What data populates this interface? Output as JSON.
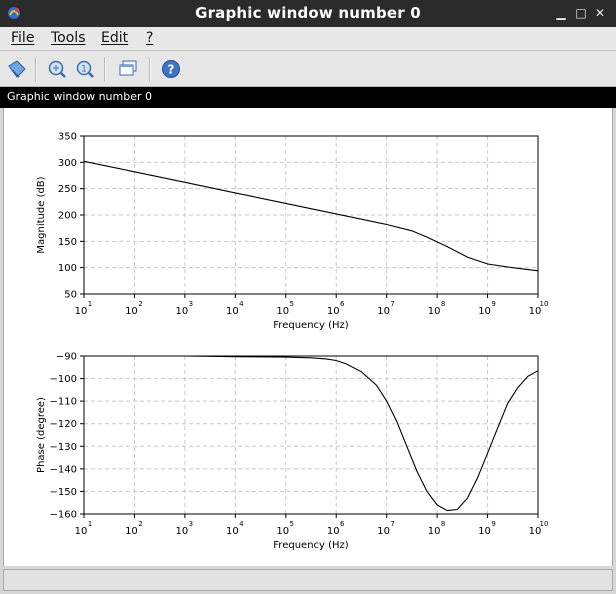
{
  "window": {
    "title": "Graphic window number 0"
  },
  "menu": [
    {
      "label": "File"
    },
    {
      "label": "Tools"
    },
    {
      "label": "Edit"
    },
    {
      "label": "?"
    }
  ],
  "toolbar": {
    "icons": [
      "datatip-icon",
      "zoom-icon",
      "unzoom-icon",
      "window-icon",
      "help-icon"
    ]
  },
  "figure": {
    "label": "Graphic window number 0"
  },
  "chart_data": [
    {
      "type": "line",
      "xscale": "log",
      "xlim": [
        10,
        10000000000
      ],
      "ylim": [
        50,
        350
      ],
      "xlabel": "Frequency (Hz)",
      "ylabel": "Magnitude (dB)",
      "grid": true,
      "xticks": [
        {
          "base": "10",
          "exp": "1"
        },
        {
          "base": "10",
          "exp": "2"
        },
        {
          "base": "10",
          "exp": "3"
        },
        {
          "base": "10",
          "exp": "4"
        },
        {
          "base": "10",
          "exp": "5"
        },
        {
          "base": "10",
          "exp": "6"
        },
        {
          "base": "10",
          "exp": "7"
        },
        {
          "base": "10",
          "exp": "8"
        },
        {
          "base": "10",
          "exp": "9"
        },
        {
          "base": "10",
          "exp": "10"
        }
      ],
      "yticks": [
        "350",
        "300",
        "250",
        "200",
        "150",
        "100",
        "50"
      ],
      "series": [
        {
          "log10_x": [
            1,
            2,
            3,
            4,
            5,
            6,
            6.5,
            7,
            7.5,
            7.8,
            8.2,
            8.6,
            9,
            9.5,
            10
          ],
          "y": [
            302,
            282,
            262,
            242,
            222,
            202,
            192,
            182,
            170,
            158,
            140,
            120,
            107,
            100,
            94
          ]
        }
      ]
    },
    {
      "type": "line",
      "xscale": "log",
      "xlim": [
        10,
        10000000000
      ],
      "ylim": [
        -160,
        -90
      ],
      "xlabel": "Frequency (Hz)",
      "ylabel": "Phase (degree)",
      "grid": true,
      "xticks": [
        {
          "base": "10",
          "exp": "1"
        },
        {
          "base": "10",
          "exp": "2"
        },
        {
          "base": "10",
          "exp": "3"
        },
        {
          "base": "10",
          "exp": "4"
        },
        {
          "base": "10",
          "exp": "5"
        },
        {
          "base": "10",
          "exp": "6"
        },
        {
          "base": "10",
          "exp": "7"
        },
        {
          "base": "10",
          "exp": "8"
        },
        {
          "base": "10",
          "exp": "9"
        },
        {
          "base": "10",
          "exp": "10"
        }
      ],
      "yticks": [
        "−90",
        "−100",
        "−110",
        "−120",
        "−130",
        "−140",
        "−150",
        "−160"
      ],
      "series": [
        {
          "log10_x": [
            1,
            2,
            3,
            4,
            5,
            5.5,
            5.8,
            6.0,
            6.2,
            6.5,
            6.8,
            7.0,
            7.2,
            7.4,
            7.6,
            7.8,
            8.0,
            8.2,
            8.4,
            8.6,
            8.8,
            9.0,
            9.2,
            9.4,
            9.6,
            9.8,
            10
          ],
          "y": [
            -90,
            -90,
            -90,
            -90.3,
            -90.5,
            -90.8,
            -91.3,
            -92,
            -93.5,
            -97,
            -103,
            -110,
            -119,
            -130,
            -141,
            -150,
            -156,
            -158.5,
            -158,
            -153,
            -144,
            -133,
            -122,
            -111,
            -104,
            -99,
            -96.5
          ]
        }
      ]
    }
  ]
}
